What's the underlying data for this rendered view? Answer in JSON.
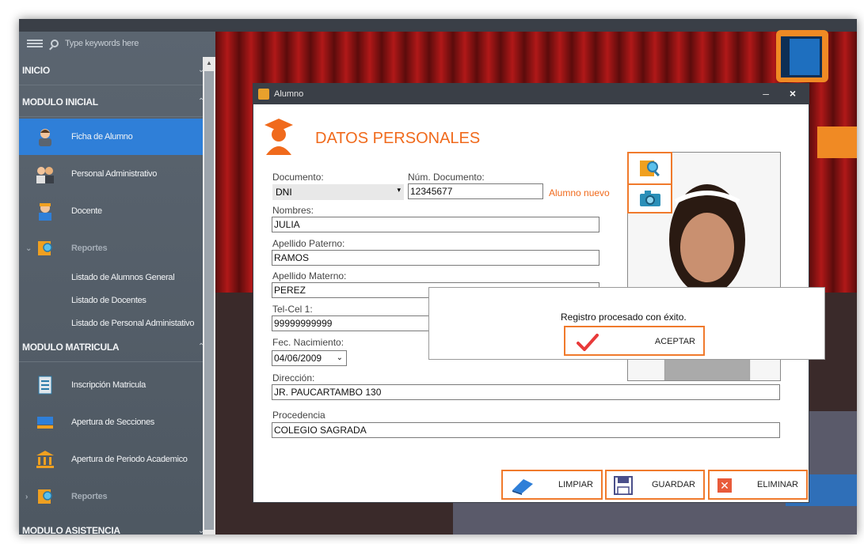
{
  "sidebar": {
    "search_placeholder": "Type keywords here",
    "sections": {
      "inicio": "INICIO",
      "modulo_inicial": "MODULO INICIAL",
      "modulo_matricula": "MODULO MATRICULA",
      "modulo_asistencia": "MODULO ASISTENCIA"
    },
    "items": {
      "ficha_alumno": "Ficha de Alumno",
      "personal_admin": "Personal Administrativo",
      "docente": "Docente",
      "reportes_1": "Reportes",
      "listado_alumnos": "Listado de Alumnos General",
      "listado_docentes": "Listado de Docentes",
      "listado_personal": "Listado de Personal Administativo",
      "inscripcion": "Inscripción Matricula",
      "apertura_secciones": "Apertura de Secciones",
      "apertura_periodo": "Apertura de Periodo Academico",
      "reportes_2": "Reportes"
    }
  },
  "dialog": {
    "window_title": "Alumno",
    "min_glyph": "–",
    "close_glyph": "×",
    "heading": "DATOS PERSONALES",
    "labels": {
      "documento": "Documento:",
      "num_documento": "Núm. Documento:",
      "nombres": "Nombres:",
      "ap_paterno": "Apellido Paterno:",
      "ap_materno": "Apellido Materno:",
      "telcel": "Tel-Cel 1:",
      "fec_nac": "Fec. Nacimiento:",
      "direccion": "Dirección:",
      "procedencia": "Procedencia"
    },
    "values": {
      "documento": "DNI",
      "num_documento": "12345677",
      "nombres": "JULIA",
      "ap_paterno": "RAMOS",
      "ap_materno": "PEREZ",
      "telcel": "99999999999",
      "fec_nac": "04/06/2009",
      "direccion": "JR. PAUCARTAMBO 130",
      "procedencia": "COLEGIO SAGRADA"
    },
    "status": "Alumno nuevo",
    "buttons": {
      "limpiar": "LIMPIAR",
      "guardar": "GUARDAR",
      "eliminar": "ELIMINAR"
    }
  },
  "message_box": {
    "text": "Registro procesado con éxito.",
    "ok_label": "ACEPTAR"
  },
  "colors": {
    "accent_orange": "#f06a1c",
    "active_blue": "#2f7fd8",
    "sidebar_bg": "#56606a",
    "titlebar": "#3a3f47"
  }
}
